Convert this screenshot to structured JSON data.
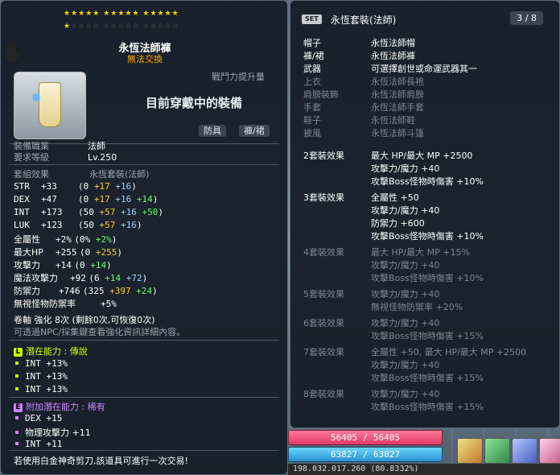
{
  "item": {
    "stars_row1": "★★★★★  ★★★★★  ★★★★★",
    "stars_row2_lit": "★",
    "stars_row2_dim": "☆☆☆☆  ☆☆☆☆☆  ☆☆☆☆☆",
    "name": "永恆法師褲",
    "trade": "無法交換",
    "power_up": "戰鬥力提升量",
    "wearing": "目前穿戴中的裝備",
    "tags": [
      "防具",
      "褲/裙"
    ],
    "job_label": "裝備職業",
    "job_value": "法師",
    "level_label": "要求等級",
    "level_value": "Lv.250",
    "set_label": "套組效果",
    "set_value": "永恆套裝(法師)",
    "stats": [
      {
        "name": "STR",
        "total": "+33",
        "base": "0",
        "flame": "+17",
        "star": "+16",
        "extra": ""
      },
      {
        "name": "DEX",
        "total": "+47",
        "base": "0",
        "flame": "+17",
        "star": "+16",
        "extra": "+14"
      },
      {
        "name": "INT",
        "total": "+173",
        "base": "50",
        "flame": "+57",
        "star": "+16",
        "extra": "+50"
      },
      {
        "name": "LUK",
        "total": "+123",
        "base": "50",
        "flame": "+57",
        "star": "+16",
        "extra": ""
      }
    ],
    "allstat": {
      "name": "全屬性",
      "total": "+2%",
      "base": "0%",
      "extra": "+2%"
    },
    "maxhp": {
      "name": "最大HP",
      "total": "+255",
      "base": "0",
      "flame": "+255"
    },
    "att": {
      "name": "攻擊力",
      "total": "+14",
      "base": "0",
      "extra": "+14"
    },
    "matt": {
      "name": "魔法攻擊力",
      "total": "+92",
      "base": "6",
      "extra": "+14",
      "star": "+72"
    },
    "def": {
      "name": "防禦力",
      "total": "+746",
      "base": "325",
      "flame": "+397",
      "extra": "+24"
    },
    "ied": {
      "name": "無視怪物防禦率",
      "total": "+5%"
    },
    "scroll": "卷軸 強化 8次 (剩餘0次,可恢復0次)",
    "npc_note": "可透過NPC/採集鍵查看強化資訊詳細內容。",
    "potential": {
      "badge": "L",
      "title": "潛在能力 : 傳說",
      "lines": [
        "INT +13%",
        "INT +13%",
        "INT +13%"
      ]
    },
    "bonus": {
      "badge": "E",
      "title": "附加潛在能力 : 稀有",
      "lines": [
        "DEX +15",
        "物理攻擊力 +11",
        "INT +11"
      ]
    },
    "footer": "若使用白金神奇剪刀,該道具可進行一次交易!"
  },
  "set": {
    "badge": "SET",
    "title": "永恆套裝(法師)",
    "count": "3 / 8",
    "pieces": [
      {
        "slot": "帽子",
        "name": "永恆法師帽",
        "on": true
      },
      {
        "slot": "褲/裙",
        "name": "永恆法師褲",
        "on": true
      },
      {
        "slot": "武器",
        "name": "可選擇創世或命運武器其一",
        "on": true
      },
      {
        "slot": "上衣",
        "name": "永恆法師長袍",
        "on": false
      },
      {
        "slot": "肩膀裝飾",
        "name": "永恆法師肩膀",
        "on": false
      },
      {
        "slot": "手套",
        "name": "永恆法師手套",
        "on": false
      },
      {
        "slot": "鞋子",
        "name": "永恆法師鞋",
        "on": false
      },
      {
        "slot": "披風",
        "name": "永恆法師斗篷",
        "on": false
      }
    ],
    "effects": [
      {
        "label": "2套裝效果",
        "on": true,
        "lines": [
          "最大 HP/最大 MP +2500",
          "攻擊力/魔力 +40",
          "攻擊Boss怪物時傷害 +10%"
        ]
      },
      {
        "label": "3套裝效果",
        "on": true,
        "lines": [
          "全屬性 +50",
          "攻擊力/魔力 +40",
          "防禦力 +600",
          "攻擊Boss怪物時傷害 +10%"
        ]
      },
      {
        "label": "4套裝效果",
        "on": false,
        "lines": [
          "最大 HP/最大 MP +15%",
          "攻擊力/魔力 +40",
          "攻擊Boss怪物時傷害 +10%"
        ]
      },
      {
        "label": "5套裝效果",
        "on": false,
        "lines": [
          "攻擊力/魔力 +40",
          "無視怪物防禦率 +20%"
        ]
      },
      {
        "label": "6套裝效果",
        "on": false,
        "lines": [
          "攻擊力/魔力 +40",
          "攻擊Boss怪物時傷害 +15%"
        ]
      },
      {
        "label": "7套裝效果",
        "on": false,
        "lines": [
          "全屬性 +50, 最大 HP/最大 MP +2500",
          "攻擊力/魔力 +40",
          "攻擊Boss怪物時傷害 +15%"
        ]
      },
      {
        "label": "8套裝效果",
        "on": false,
        "lines": [
          "攻擊力/魔力 +40",
          "攻擊Boss怪物時傷害 +15%"
        ]
      }
    ]
  },
  "hud": {
    "hp": "56405 / 56405",
    "mp": "63827 / 63827",
    "exp": "198.032.017.260 (80.8332%)"
  },
  "colors": {
    "trade": "#ffaa00",
    "flame": "#ffcc33",
    "star": "#9bd0ff",
    "extra": "#66ff66",
    "legend": "#ccff00",
    "rare": "#cc88ff"
  }
}
